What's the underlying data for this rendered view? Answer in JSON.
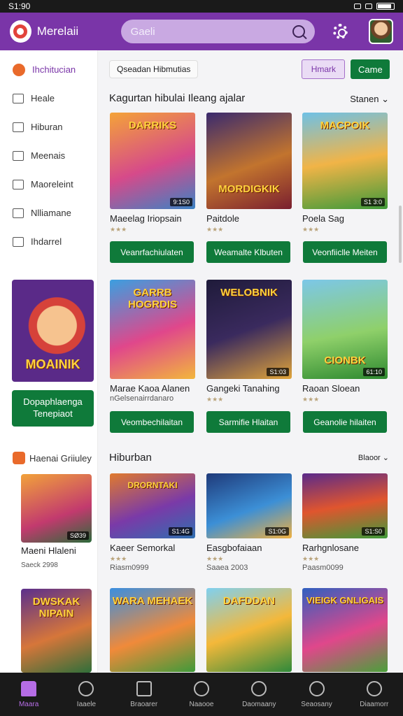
{
  "status": {
    "time": "S1:90"
  },
  "app": {
    "brand": "Merelaii"
  },
  "search": {
    "placeholder": "Gaeli"
  },
  "sidebar": {
    "items": [
      {
        "label": "Ihchitucian",
        "icon": "fox-icon"
      },
      {
        "label": "Heale",
        "icon": "grid-icon"
      },
      {
        "label": "Hiburan",
        "icon": "gamepad-icon"
      },
      {
        "label": "Meenais",
        "icon": "house-icon"
      },
      {
        "label": "Maoreleint",
        "icon": "shield-icon"
      },
      {
        "label": "Nlliamane",
        "icon": "monitor-icon"
      },
      {
        "label": "Ihdarrel",
        "icon": "hand-icon"
      }
    ],
    "promo": {
      "title": "MOAINIK",
      "button": "Dopaphlaenga Tenepiaot"
    },
    "section": "Haenai Griiuley",
    "cards": [
      {
        "title": "Maeni Hlaleni",
        "meta": "Saeck 2998",
        "badge": "SØ39"
      },
      {
        "title": "",
        "meta": "",
        "art": "DWSKAK NIPAIN"
      }
    ]
  },
  "toolbar": {
    "chip": "Qseadan Hibmutias",
    "purple": "Hmark",
    "green": "Came"
  },
  "section1": {
    "title": "Kagurtan hibulai  Ileang ajalar",
    "sort": "Stanen"
  },
  "row1": [
    {
      "title": "Maeelag Iriopsain",
      "badge": "9:1S0",
      "art": "DARRIKS",
      "button": "Veanrfachiulaten"
    },
    {
      "title": "Paitdole",
      "badge": "",
      "art": "MORDIGKIK",
      "button": "Weamalte Klbuten"
    },
    {
      "title": "Poela Sag",
      "badge": "S1 3:0",
      "art": "MACPOIK",
      "button": "Veonfiiclle Meiten"
    }
  ],
  "row2": [
    {
      "title": "Marae Kaoa Alanen",
      "sub": "nGelsenairrdanaro",
      "badge": "",
      "art": "GARRB HOGRDIS",
      "button": "Veombechilaitan"
    },
    {
      "title": "Gangeki Tanahing",
      "sub": "",
      "badge": "S1:03",
      "art": "WELOBNIK",
      "button": "Sarmifie Hlaitan"
    },
    {
      "title": "Raoan Sloean",
      "sub": "",
      "badge": "61:10",
      "art": "CIONBK",
      "button": "Geanolie hilaiten"
    }
  ],
  "section2": {
    "title": "Hiburban",
    "sort": "Blaoor"
  },
  "row3": [
    {
      "title": "Kaeer Semorkal",
      "sub": "Riasm0999",
      "badge": "S1:4G",
      "art": "DRORNTAKI"
    },
    {
      "title": "Easgbofaiaan",
      "sub": "Saaea 2003",
      "badge": "S1:0G",
      "art": ""
    },
    {
      "title": "Rarhgnlosane",
      "sub": "Paasm0099",
      "badge": "S1:S0",
      "art": ""
    }
  ],
  "row4": [
    {
      "art": "WARA MEHAEK"
    },
    {
      "art": "DAFDDAN"
    },
    {
      "art": "VIEIGK GNLIGAIS"
    }
  ],
  "nav": [
    {
      "label": "Maara",
      "icon": "home-icon"
    },
    {
      "label": "Iaaele",
      "icon": "search-icon"
    },
    {
      "label": "Braoarer",
      "icon": "gift-icon"
    },
    {
      "label": "Naaooe",
      "icon": "clock-icon"
    },
    {
      "label": "Daomaany",
      "icon": "chat-icon"
    },
    {
      "label": "Seaosany",
      "icon": "bell-icon"
    },
    {
      "label": "Diaamorr",
      "icon": "profile-icon"
    }
  ],
  "colors": {
    "purple": "#7a35a8",
    "green": "#0f7a3a",
    "orange": "#e96a2b"
  }
}
